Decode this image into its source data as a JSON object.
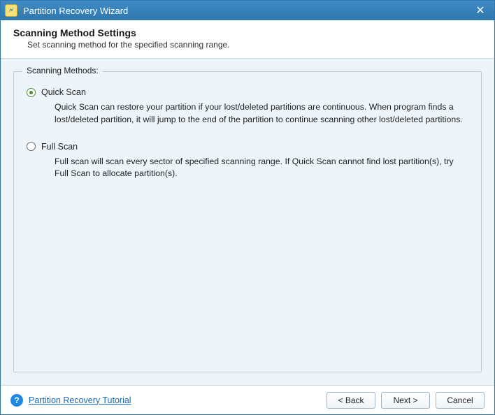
{
  "window": {
    "title": "Partition Recovery Wizard",
    "close_glyph": "✕"
  },
  "header": {
    "title": "Scanning Method Settings",
    "subtitle": "Set scanning method for the specified scanning range."
  },
  "group": {
    "legend": "Scanning Methods:",
    "options": [
      {
        "label": "Quick Scan",
        "selected": true,
        "description": "Quick Scan can restore your partition if your lost/deleted partitions are continuous. When program finds a lost/deleted partition, it will jump to the end of the partition to continue scanning other lost/deleted partitions."
      },
      {
        "label": "Full Scan",
        "selected": false,
        "description": "Full scan will scan every sector of specified scanning range. If Quick Scan cannot find lost partition(s), try Full Scan to allocate partition(s)."
      }
    ]
  },
  "footer": {
    "help_link": "Partition Recovery Tutorial",
    "back": "< Back",
    "next": "Next >",
    "cancel": "Cancel"
  }
}
